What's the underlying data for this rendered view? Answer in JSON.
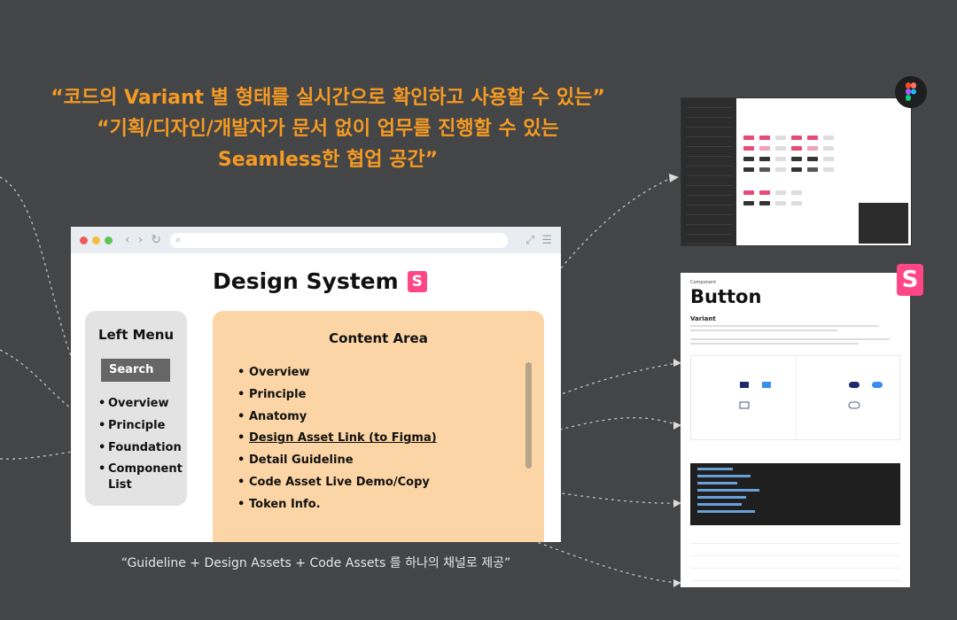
{
  "headline": {
    "line1": "“코드의 Variant 별 형태를 실시간으로 확인하고 사용할 수 있는”",
    "line2": "“기획/디자인/개발자가 문서 없이 업무를 진행할 수 있는",
    "line3": "Seamless한 협업 공간”"
  },
  "caption": "“Guideline + Design Assets + Code Assets 를 하나의 채널로 제공”",
  "browser": {
    "title": "Design System",
    "logo_letter": "S",
    "left_menu": {
      "title": "Left Menu",
      "search_label": "Search",
      "items": [
        "Overview",
        "Principle",
        "Foundation",
        "Component List"
      ]
    },
    "content_area": {
      "title": "Content Area",
      "items": [
        "Overview",
        "Principle",
        "Anatomy",
        "Design Asset Link (to Figma)",
        "Detail Guideline",
        "Code Asset Live Demo/Copy",
        "Token Info."
      ]
    }
  },
  "storybook": {
    "category": "Component",
    "title": "Button",
    "section": "Variant",
    "logo_letter": "S"
  },
  "colors": {
    "background": "#444546",
    "accent": "#f59a23",
    "content_area": "#fbd5a5",
    "storybook": "#ff4785"
  }
}
